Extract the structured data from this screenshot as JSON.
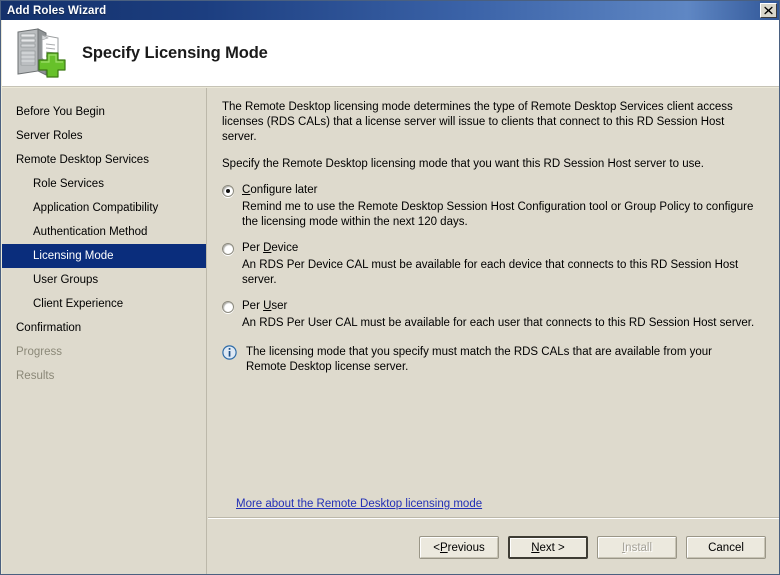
{
  "window": {
    "title": "Add Roles Wizard",
    "close_icon": "close-icon"
  },
  "header": {
    "title": "Specify Licensing Mode",
    "icon": "server-add-icon"
  },
  "sidebar": {
    "items": [
      {
        "label": "Before You Begin",
        "indent": false,
        "state": "normal"
      },
      {
        "label": "Server Roles",
        "indent": false,
        "state": "normal"
      },
      {
        "label": "Remote Desktop Services",
        "indent": false,
        "state": "normal"
      },
      {
        "label": "Role Services",
        "indent": true,
        "state": "normal"
      },
      {
        "label": "Application Compatibility",
        "indent": true,
        "state": "normal"
      },
      {
        "label": "Authentication Method",
        "indent": true,
        "state": "normal"
      },
      {
        "label": "Licensing Mode",
        "indent": true,
        "state": "selected"
      },
      {
        "label": "User Groups",
        "indent": true,
        "state": "normal"
      },
      {
        "label": "Client Experience",
        "indent": true,
        "state": "normal"
      },
      {
        "label": "Confirmation",
        "indent": false,
        "state": "normal"
      },
      {
        "label": "Progress",
        "indent": false,
        "state": "disabled"
      },
      {
        "label": "Results",
        "indent": false,
        "state": "disabled"
      }
    ]
  },
  "content": {
    "intro_paragraph": "The Remote Desktop licensing mode determines the type of Remote Desktop Services client access licenses (RDS CALs) that a license server will issue to clients that connect to this RD Session Host server.",
    "instruction_paragraph": "Specify the Remote Desktop licensing mode that you want this RD Session Host server to use.",
    "options": [
      {
        "label_before": "",
        "accelerator": "C",
        "label_after": "onfigure later",
        "full_label": "Configure later",
        "selected": true,
        "description": "Remind me to use the Remote Desktop Session Host Configuration tool or Group Policy to configure the licensing mode within the next 120 days."
      },
      {
        "label_before": "Per ",
        "accelerator": "D",
        "label_after": "evice",
        "full_label": "Per Device",
        "selected": false,
        "description": "An RDS Per Device CAL must be available for each device that connects to this RD Session Host server."
      },
      {
        "label_before": "Per ",
        "accelerator": "U",
        "label_after": "ser",
        "full_label": "Per User",
        "selected": false,
        "description": "An RDS Per User CAL must be available for each user that connects to this RD Session Host server."
      }
    ],
    "info_note": {
      "icon": "info-icon",
      "text": "The licensing mode that you specify must match the RDS CALs that are available from your Remote Desktop license server."
    },
    "more_link": "More about the Remote Desktop licensing mode"
  },
  "buttons": [
    {
      "label_before": "< ",
      "accelerator": "P",
      "label_after": "revious",
      "full_label": "< Previous",
      "state": "normal"
    },
    {
      "label_before": "",
      "accelerator": "N",
      "label_after": "ext >",
      "full_label": "Next >",
      "state": "default"
    },
    {
      "label_before": "",
      "accelerator": "I",
      "label_after": "nstall",
      "full_label": "Install",
      "state": "disabled"
    },
    {
      "label_before": "Cancel",
      "accelerator": "",
      "label_after": "",
      "full_label": "Cancel",
      "state": "normal"
    }
  ],
  "colors": {
    "titlebar_start": "#14316b",
    "titlebar_end": "#5f87c4",
    "selection": "#0a2d7c",
    "panel_bg": "#dedacd",
    "header_bg": "#ffffff",
    "link": "#2330b6",
    "disabled_text": "#8b8878"
  }
}
